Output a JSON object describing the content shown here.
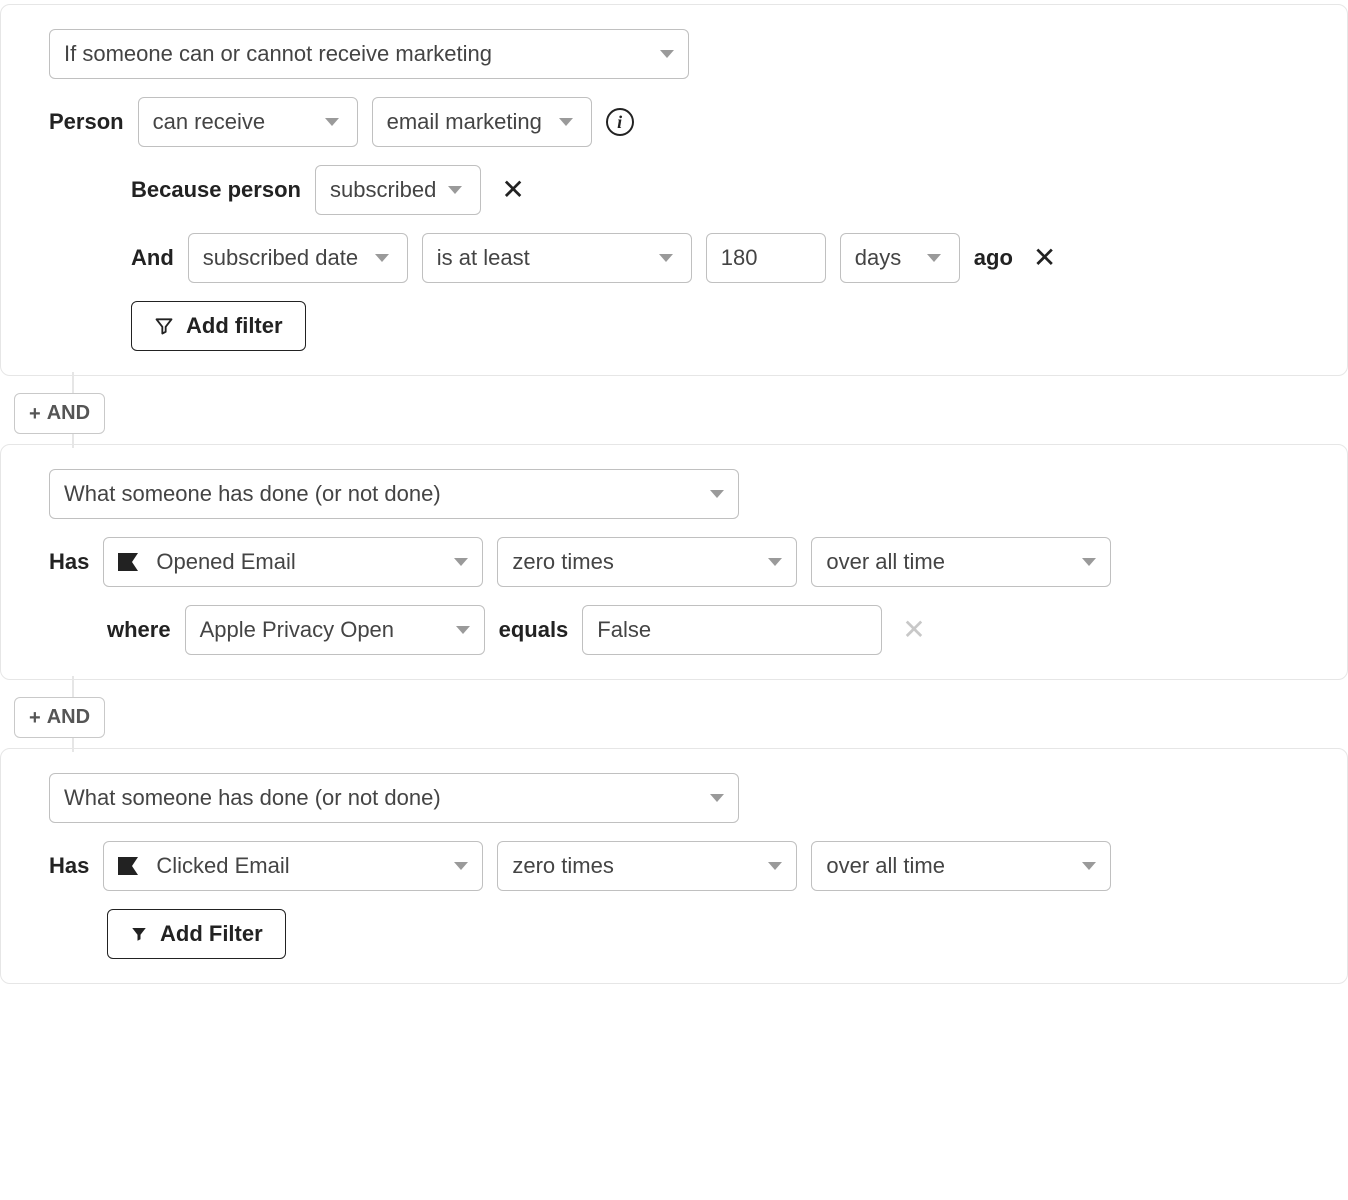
{
  "connectors": {
    "and_label": "AND"
  },
  "block1": {
    "condition_type": "If someone can or cannot receive marketing",
    "person_label": "Person",
    "can_receive": "can receive",
    "channel": "email marketing",
    "because_label": "Because person",
    "because_value": "subscribed",
    "and_label": "And",
    "date_field": "subscribed date",
    "date_comparator": "is at least",
    "date_value": "180",
    "date_unit": "days",
    "ago_label": "ago",
    "add_filter_label": "Add filter"
  },
  "block2": {
    "condition_type": "What someone has done (or not done)",
    "has_label": "Has",
    "metric": "Opened Email",
    "count": "zero times",
    "timeframe": "over all time",
    "where_label": "where",
    "where_field": "Apple Privacy Open",
    "where_op": "equals",
    "where_value": "False"
  },
  "block3": {
    "condition_type": "What someone has done (or not done)",
    "has_label": "Has",
    "metric": "Clicked Email",
    "count": "zero times",
    "timeframe": "over all time",
    "add_filter_label": "Add Filter"
  }
}
